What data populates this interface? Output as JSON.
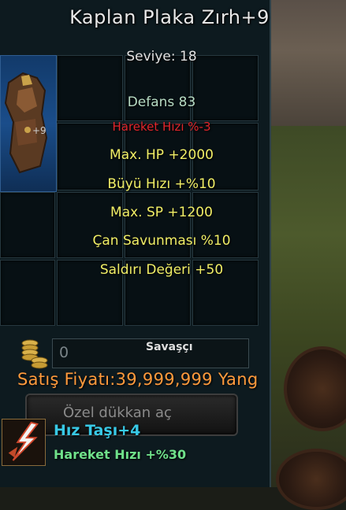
{
  "tooltip": {
    "title": "Kaplan Plaka Zırh+9",
    "level": "Seviye: 18",
    "defense": "Defans 83",
    "speed_penalty": "Hareket Hızı %-3",
    "bonuses": [
      "Max. HP +2000",
      "Büyü Hızı +%10",
      "Max. SP +1200",
      "Çan Savunması %10",
      "Saldırı Değeri +50"
    ]
  },
  "inventory": {
    "item_refine_label": "+9"
  },
  "vendor": {
    "money_value": "0",
    "class_label": "Savaşçı",
    "sell_price": "Satış Fiyatı:39,999,999 Yang",
    "shop_button_label": "Özel dükkan aç"
  },
  "bottom_item": {
    "name": "Hız Taşı+4",
    "bonus": "Hareket Hızı +%30"
  },
  "colors": {
    "title": "#e8e8e8",
    "defense": "#b8dcc4",
    "penalty": "#e0252b",
    "bonus": "#f1ee66",
    "price": "#ff9a3c",
    "stone_name": "#38c9e6",
    "stone_bonus": "#6fe08a"
  },
  "icons": {
    "armor": "armor-icon",
    "coins": "coins-icon",
    "stone": "speed-stone-icon"
  }
}
